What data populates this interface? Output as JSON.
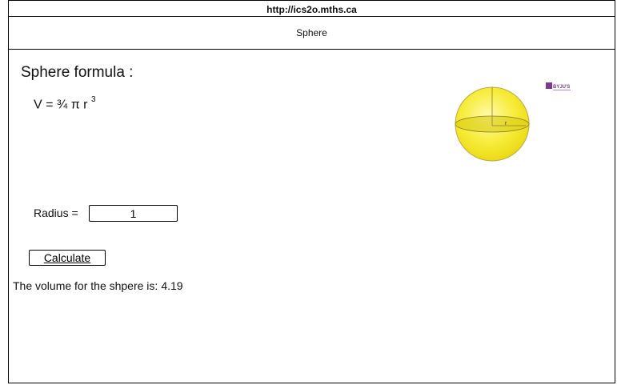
{
  "browser": {
    "url": "http://ics2o.mths.ca",
    "tab_title": "Sphere"
  },
  "main": {
    "heading": "Sphere formula :",
    "formula_base": "V = ¾ π r",
    "formula_exponent": "3",
    "radius_label": "Radius =",
    "radius_value": "1",
    "calculate_label": "Calculate",
    "result_text": "The volume for the shpere is:",
    "result_value": "4.19"
  },
  "image": {
    "radius_marker": "r",
    "logo_text": "BYJU'S",
    "sphere_color": "#f7ec3a",
    "logo_color": "#7b3a8f"
  }
}
